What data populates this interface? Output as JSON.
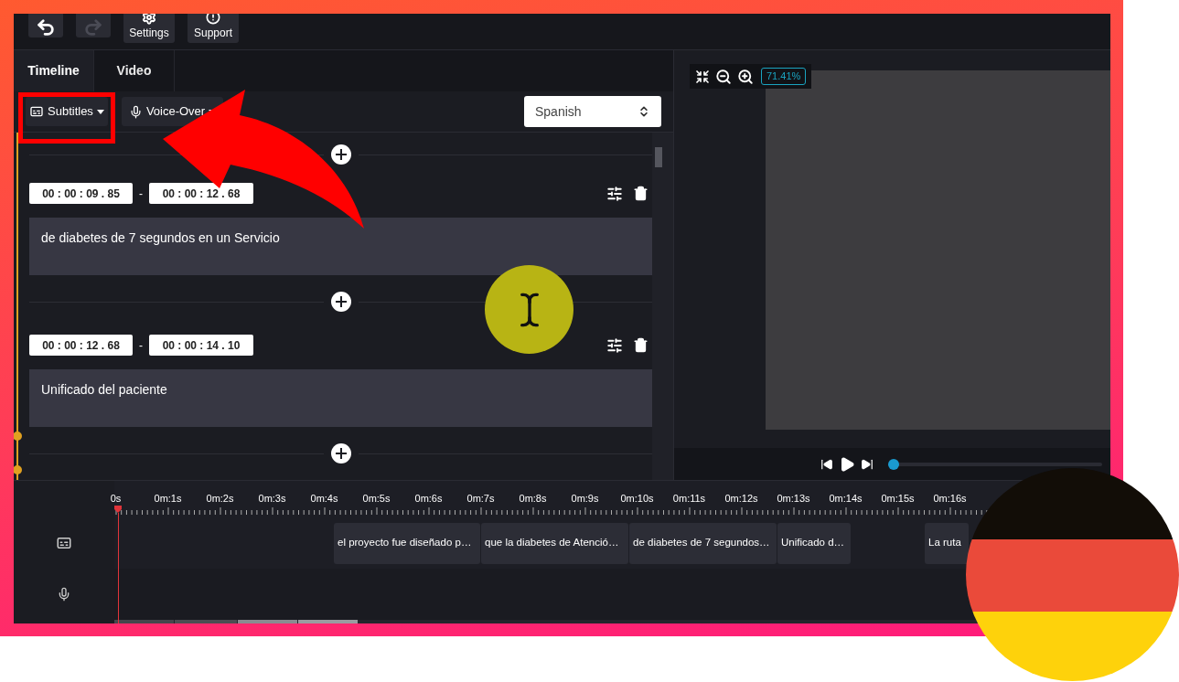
{
  "toolbar": [
    {
      "kind": "undo",
      "disabled": false
    },
    {
      "kind": "redo",
      "disabled": true
    },
    {
      "kind": "settings",
      "label": "Settings"
    },
    {
      "kind": "support",
      "label": "Support"
    }
  ],
  "tabs": [
    {
      "label": "Timeline",
      "selected": true
    },
    {
      "label": "Video",
      "selected": false
    }
  ],
  "subtitle_toolbar": {
    "subtitles_button": "Subtitles",
    "voice_over_button": "Voice-Over",
    "language": "Spanish"
  },
  "subtitles": [
    {
      "start": "00 : 00 : 09 . 85",
      "separator": "-",
      "end": "00 : 00 : 12 . 68",
      "text": "de diabetes de 7 segundos en un Servicio"
    },
    {
      "start": "00 : 00 : 12 . 68",
      "separator": "-",
      "end": "00 : 00 : 14 . 10",
      "text": "Unificado del paciente"
    }
  ],
  "preview": {
    "zoom": "71.41%",
    "playback": {
      "level": 0
    }
  },
  "timeline": {
    "ticks": [
      "0s",
      "0m:1s",
      "0m:2s",
      "0m:3s",
      "0m:4s",
      "0m:5s",
      "0m:6s",
      "0m:7s",
      "0m:8s",
      "0m:9s",
      "0m:10s",
      "0m:11s",
      "0m:12s",
      "0m:13s",
      "0m:14s",
      "0m:15s",
      "0m:16s"
    ],
    "clips": [
      "el proyecto fue diseñado p…",
      "que la diabetes de Atenció…",
      "de diabetes de 7 segundos…",
      "Unificado d…",
      "La ruta"
    ]
  }
}
